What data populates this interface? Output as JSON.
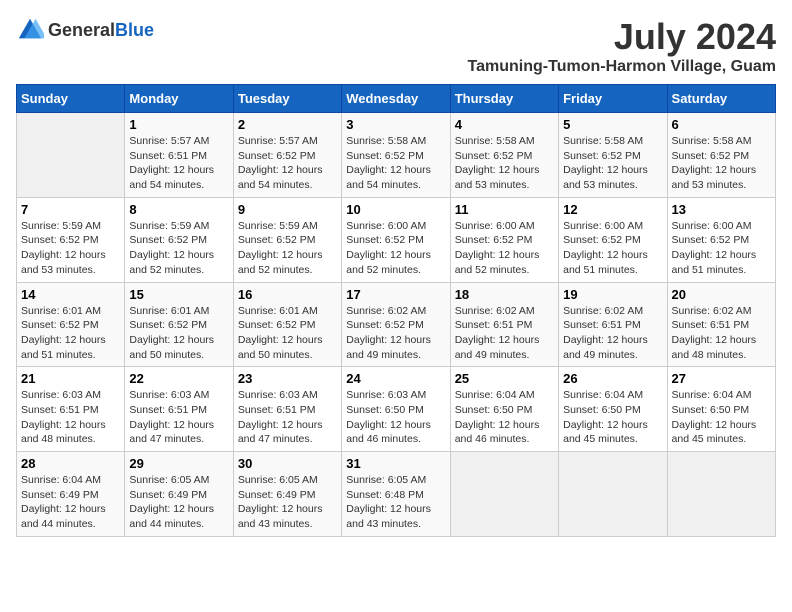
{
  "logo": {
    "text_general": "General",
    "text_blue": "Blue"
  },
  "title": {
    "month": "July 2024",
    "location": "Tamuning-Tumon-Harmon Village, Guam"
  },
  "calendar": {
    "headers": [
      "Sunday",
      "Monday",
      "Tuesday",
      "Wednesday",
      "Thursday",
      "Friday",
      "Saturday"
    ],
    "weeks": [
      [
        {
          "day": "",
          "info": ""
        },
        {
          "day": "1",
          "info": "Sunrise: 5:57 AM\nSunset: 6:51 PM\nDaylight: 12 hours\nand 54 minutes."
        },
        {
          "day": "2",
          "info": "Sunrise: 5:57 AM\nSunset: 6:52 PM\nDaylight: 12 hours\nand 54 minutes."
        },
        {
          "day": "3",
          "info": "Sunrise: 5:58 AM\nSunset: 6:52 PM\nDaylight: 12 hours\nand 54 minutes."
        },
        {
          "day": "4",
          "info": "Sunrise: 5:58 AM\nSunset: 6:52 PM\nDaylight: 12 hours\nand 53 minutes."
        },
        {
          "day": "5",
          "info": "Sunrise: 5:58 AM\nSunset: 6:52 PM\nDaylight: 12 hours\nand 53 minutes."
        },
        {
          "day": "6",
          "info": "Sunrise: 5:58 AM\nSunset: 6:52 PM\nDaylight: 12 hours\nand 53 minutes."
        }
      ],
      [
        {
          "day": "7",
          "info": "Sunrise: 5:59 AM\nSunset: 6:52 PM\nDaylight: 12 hours\nand 53 minutes."
        },
        {
          "day": "8",
          "info": "Sunrise: 5:59 AM\nSunset: 6:52 PM\nDaylight: 12 hours\nand 52 minutes."
        },
        {
          "day": "9",
          "info": "Sunrise: 5:59 AM\nSunset: 6:52 PM\nDaylight: 12 hours\nand 52 minutes."
        },
        {
          "day": "10",
          "info": "Sunrise: 6:00 AM\nSunset: 6:52 PM\nDaylight: 12 hours\nand 52 minutes."
        },
        {
          "day": "11",
          "info": "Sunrise: 6:00 AM\nSunset: 6:52 PM\nDaylight: 12 hours\nand 52 minutes."
        },
        {
          "day": "12",
          "info": "Sunrise: 6:00 AM\nSunset: 6:52 PM\nDaylight: 12 hours\nand 51 minutes."
        },
        {
          "day": "13",
          "info": "Sunrise: 6:00 AM\nSunset: 6:52 PM\nDaylight: 12 hours\nand 51 minutes."
        }
      ],
      [
        {
          "day": "14",
          "info": "Sunrise: 6:01 AM\nSunset: 6:52 PM\nDaylight: 12 hours\nand 51 minutes."
        },
        {
          "day": "15",
          "info": "Sunrise: 6:01 AM\nSunset: 6:52 PM\nDaylight: 12 hours\nand 50 minutes."
        },
        {
          "day": "16",
          "info": "Sunrise: 6:01 AM\nSunset: 6:52 PM\nDaylight: 12 hours\nand 50 minutes."
        },
        {
          "day": "17",
          "info": "Sunrise: 6:02 AM\nSunset: 6:52 PM\nDaylight: 12 hours\nand 49 minutes."
        },
        {
          "day": "18",
          "info": "Sunrise: 6:02 AM\nSunset: 6:51 PM\nDaylight: 12 hours\nand 49 minutes."
        },
        {
          "day": "19",
          "info": "Sunrise: 6:02 AM\nSunset: 6:51 PM\nDaylight: 12 hours\nand 49 minutes."
        },
        {
          "day": "20",
          "info": "Sunrise: 6:02 AM\nSunset: 6:51 PM\nDaylight: 12 hours\nand 48 minutes."
        }
      ],
      [
        {
          "day": "21",
          "info": "Sunrise: 6:03 AM\nSunset: 6:51 PM\nDaylight: 12 hours\nand 48 minutes."
        },
        {
          "day": "22",
          "info": "Sunrise: 6:03 AM\nSunset: 6:51 PM\nDaylight: 12 hours\nand 47 minutes."
        },
        {
          "day": "23",
          "info": "Sunrise: 6:03 AM\nSunset: 6:51 PM\nDaylight: 12 hours\nand 47 minutes."
        },
        {
          "day": "24",
          "info": "Sunrise: 6:03 AM\nSunset: 6:50 PM\nDaylight: 12 hours\nand 46 minutes."
        },
        {
          "day": "25",
          "info": "Sunrise: 6:04 AM\nSunset: 6:50 PM\nDaylight: 12 hours\nand 46 minutes."
        },
        {
          "day": "26",
          "info": "Sunrise: 6:04 AM\nSunset: 6:50 PM\nDaylight: 12 hours\nand 45 minutes."
        },
        {
          "day": "27",
          "info": "Sunrise: 6:04 AM\nSunset: 6:50 PM\nDaylight: 12 hours\nand 45 minutes."
        }
      ],
      [
        {
          "day": "28",
          "info": "Sunrise: 6:04 AM\nSunset: 6:49 PM\nDaylight: 12 hours\nand 44 minutes."
        },
        {
          "day": "29",
          "info": "Sunrise: 6:05 AM\nSunset: 6:49 PM\nDaylight: 12 hours\nand 44 minutes."
        },
        {
          "day": "30",
          "info": "Sunrise: 6:05 AM\nSunset: 6:49 PM\nDaylight: 12 hours\nand 43 minutes."
        },
        {
          "day": "31",
          "info": "Sunrise: 6:05 AM\nSunset: 6:48 PM\nDaylight: 12 hours\nand 43 minutes."
        },
        {
          "day": "",
          "info": ""
        },
        {
          "day": "",
          "info": ""
        },
        {
          "day": "",
          "info": ""
        }
      ]
    ]
  }
}
